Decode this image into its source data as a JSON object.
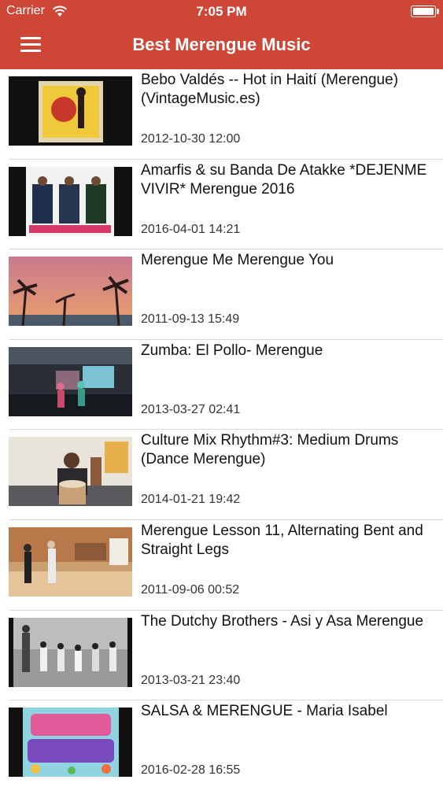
{
  "status": {
    "carrier": "Carrier",
    "time": "7:05 PM"
  },
  "header": {
    "title": "Best Merengue Music",
    "menu_icon": "hamburger-menu-icon"
  },
  "colors": {
    "accent": "#cd4636",
    "separator": "#d9d9d9"
  },
  "videos": [
    {
      "title": "Bebo Valdés -- Hot in Haití (Merengue) (VintageMusic.es)",
      "date": "2012-10-30 12:00"
    },
    {
      "title": "Amarfis & su Banda De Atakke *DEJENME VIVIR* Merengue 2016",
      "date": "2016-04-01 14:21"
    },
    {
      "title": "Merengue Me Merengue You",
      "date": "2011-09-13 15:49"
    },
    {
      "title": "Zumba: El Pollo- Merengue",
      "date": "2013-03-27 02:41"
    },
    {
      "title": "Culture Mix Rhythm#3: Medium Drums (Dance Merengue)",
      "date": "2014-01-21 19:42"
    },
    {
      "title": "Merengue Lesson 11, Alternating Bent and Straight Legs",
      "date": "2011-09-06 00:52"
    },
    {
      "title": "The Dutchy Brothers - Asi y Asa Merengue",
      "date": "2013-03-21 23:40"
    },
    {
      "title": "SALSA & MERENGUE - Maria Isabel",
      "date": "2016-02-28 16:55"
    }
  ]
}
